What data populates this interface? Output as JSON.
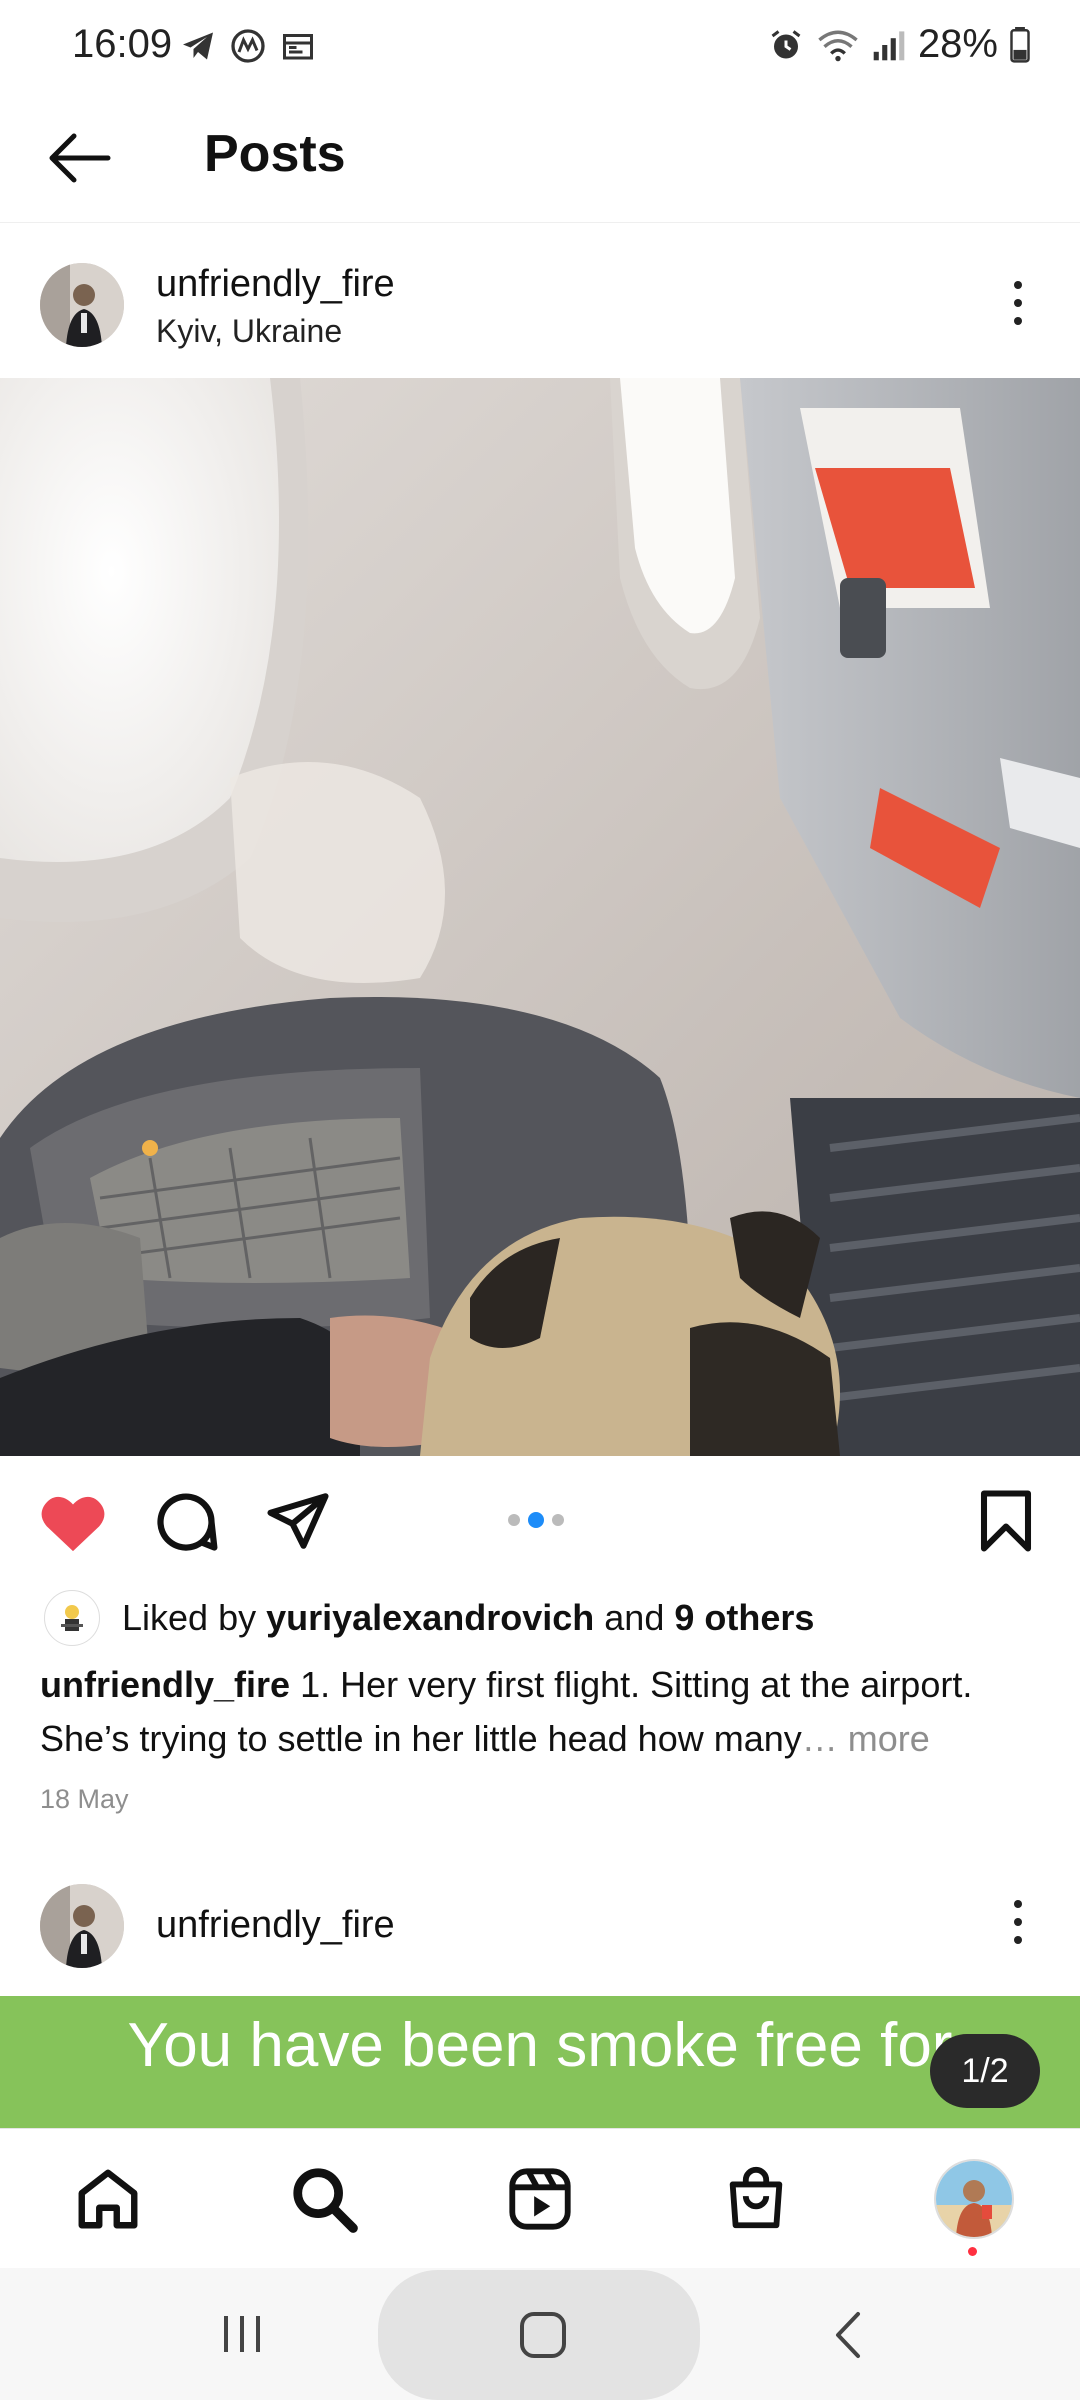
{
  "status_bar": {
    "time": "16:09",
    "battery": "28%",
    "icons": [
      "telegram-icon",
      "coinmarket-icon",
      "calendar-icon",
      "alarm-icon",
      "wifi-icon",
      "signal-icon",
      "battery-icon"
    ]
  },
  "header": {
    "title": "Posts"
  },
  "post": {
    "username": "unfriendly_fire",
    "location": "Kyiv, Ukraine",
    "liked_prefix": "Liked by",
    "liked_user": "yuriyalexandrovich",
    "liked_and": "and",
    "liked_others": "9 others",
    "caption_user": "unfriendly_fire",
    "caption_text": "1. Her very first flight. Sitting at the airport. She’s trying to settle in her little head how many",
    "caption_ellipsis": "…",
    "more": "more",
    "date": "18 May",
    "carousel": {
      "count": 3,
      "active": 1
    },
    "liked": true,
    "colors": {
      "like": "#ed4956",
      "pager_active": "#1d8cf8"
    }
  },
  "next_post": {
    "username": "unfriendly_fire"
  },
  "banner": {
    "text": "You have been smoke free for",
    "counter": "1/2",
    "color": "#86c35a"
  },
  "bottom_nav": [
    "home-icon",
    "search-icon",
    "reels-icon",
    "shop-icon",
    "profile-avatar"
  ]
}
